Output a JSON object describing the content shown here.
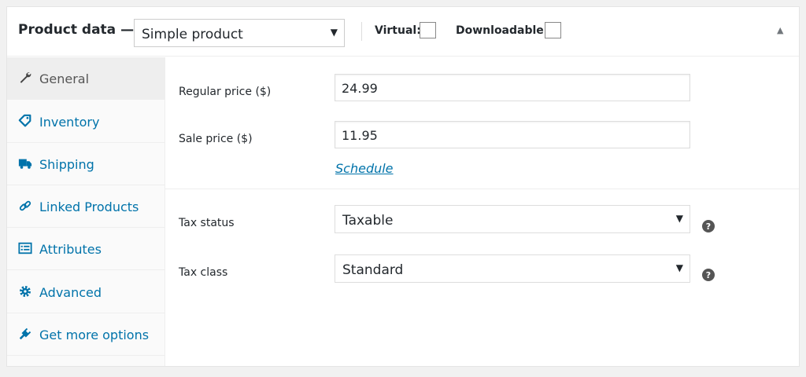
{
  "header": {
    "title": "Product data —",
    "product_type": {
      "selected": "Simple product",
      "options": [
        "Simple product"
      ],
      "caret": "▼"
    },
    "virtual": {
      "label": "Virtual:",
      "checked": false
    },
    "downloadable": {
      "label": "Downloadable:",
      "checked": false
    },
    "collapse_icon": "▲"
  },
  "sidebar": {
    "items": [
      {
        "label": "General",
        "icon": "wrench-icon",
        "active": true
      },
      {
        "label": "Inventory",
        "icon": "tag-icon",
        "active": false
      },
      {
        "label": "Shipping",
        "icon": "truck-icon",
        "active": false
      },
      {
        "label": "Linked Products",
        "icon": "link-icon",
        "active": false
      },
      {
        "label": "Attributes",
        "icon": "list-icon",
        "active": false
      },
      {
        "label": "Advanced",
        "icon": "gear-icon",
        "active": false
      },
      {
        "label": "Get more options",
        "icon": "plugin-icon",
        "active": false
      }
    ]
  },
  "general": {
    "regular_price": {
      "label": "Regular price ($)",
      "value": "24.99"
    },
    "sale_price": {
      "label": "Sale price ($)",
      "value": "11.95"
    },
    "schedule_link": "Schedule",
    "tax_status": {
      "label": "Tax status",
      "selected": "Taxable",
      "caret": "▼"
    },
    "tax_class": {
      "label": "Tax class",
      "selected": "Standard",
      "caret": "▼"
    }
  },
  "colors": {
    "link": "#0073aa",
    "icon": "#0073aa",
    "active_tab_bg": "#eeeeee",
    "help_icon": "#555555"
  }
}
